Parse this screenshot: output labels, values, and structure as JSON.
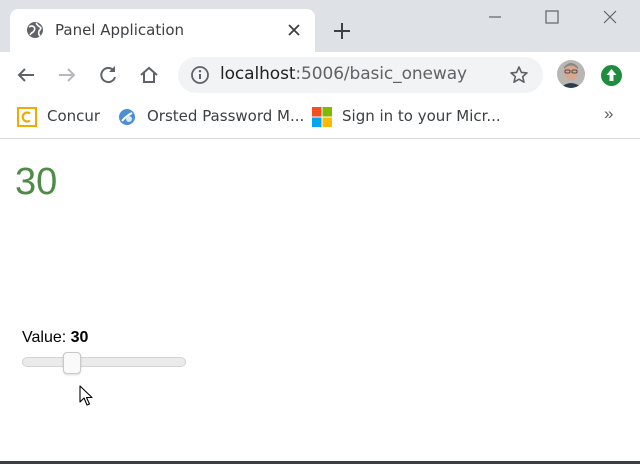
{
  "browser": {
    "tab": {
      "title": "Panel Application"
    },
    "address_bar": {
      "host": "localhost",
      "rest": ":5006/basic_oneway"
    },
    "bookmarks": [
      {
        "label": "Concur",
        "icon": "concur-icon"
      },
      {
        "label": "Orsted Password M...",
        "icon": "password-icon"
      },
      {
        "label": "Sign in to your Micr...",
        "icon": "microsoft-icon"
      }
    ],
    "bookmarks_more": "»"
  },
  "page": {
    "display_value": "30",
    "slider": {
      "label_prefix": "Value: ",
      "value_text": "30",
      "value": 30,
      "min": 0,
      "max": 100
    }
  },
  "colors": {
    "value_text": "#4d8b46",
    "tab_strip": "#dee1e6",
    "omnibox": "#f1f3f4",
    "extension": "#1e8e3e"
  }
}
